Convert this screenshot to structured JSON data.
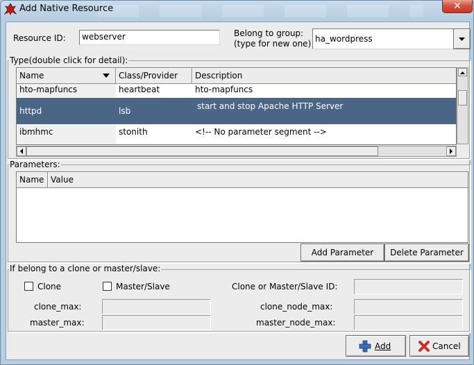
{
  "window": {
    "title": "Add Native Resource",
    "close_glyph": "✕"
  },
  "form": {
    "resource_id_label": "Resource ID:",
    "resource_id_value": "webserver",
    "group_label_line1": "Belong to group:",
    "group_label_line2": "(type for new one)",
    "group_value": "ha_wordpress"
  },
  "types": {
    "legend": "Type(double click for detail):",
    "columns": [
      "Name",
      "Class/Provider",
      "Description"
    ],
    "rows": [
      {
        "name": "hto-mapfuncs",
        "provider": "heartbeat",
        "description": "hto-mapfuncs"
      },
      {
        "name": "httpd",
        "provider": "lsb",
        "description": "start and stop Apache HTTP Server"
      },
      {
        "name": "ibmhmc",
        "provider": "stonith",
        "description": "<!-- No parameter segment -->"
      }
    ],
    "selected_row": 1
  },
  "parameters": {
    "legend": "Parameters:",
    "columns": [
      "Name",
      "Value"
    ],
    "add_button": "Add Parameter",
    "delete_button": "Delete Parameter"
  },
  "clone": {
    "legend": "If belong to a clone or master/slave:",
    "clone_checkbox": "Clone",
    "master_slave_checkbox": "Master/Slave",
    "clone_id_label": "Clone or Master/Slave ID:",
    "clone_max_label": "clone_max:",
    "clone_node_max_label": "clone_node_max:",
    "master_max_label": "master_max:",
    "master_node_max_label": "master_node_max:"
  },
  "actions": {
    "add_label": "Add",
    "cancel_label": "Cancel"
  },
  "colors": {
    "selection": "#4a6585",
    "close_button": "#c9432e"
  }
}
